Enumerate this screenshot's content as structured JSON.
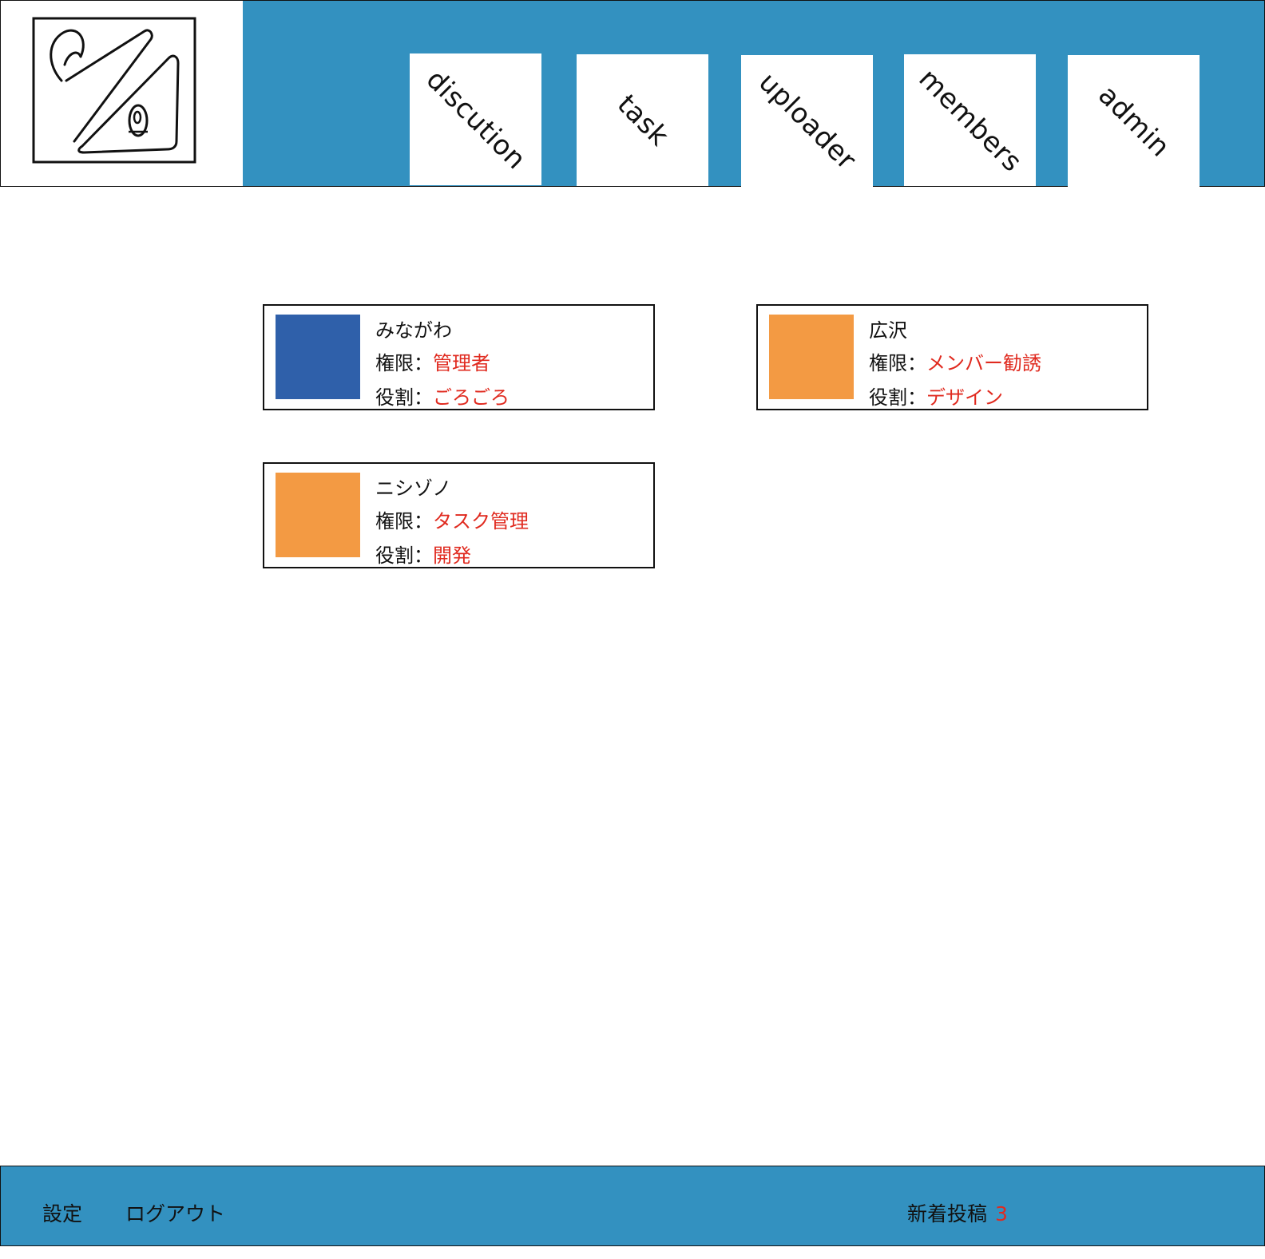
{
  "header": {
    "tabs": [
      {
        "label": "discution"
      },
      {
        "label": "task"
      },
      {
        "label": "uploader"
      },
      {
        "label": "members"
      },
      {
        "label": "admin"
      }
    ]
  },
  "members": [
    {
      "name": "みながわ",
      "auth_label": "権限：",
      "auth": "管理者",
      "role_label": "役割：",
      "role": "ごろごろ",
      "color": "#2f60aa"
    },
    {
      "name": "広沢",
      "auth_label": "権限：",
      "auth": "メンバー勧誘",
      "role_label": "役割：",
      "role": "デザイン",
      "color": "#f39a43"
    },
    {
      "name": "ニシゾノ",
      "auth_label": "権限：",
      "auth": "タスク管理",
      "role_label": "役割：",
      "role": "開発",
      "color": "#f39a43"
    }
  ],
  "footer": {
    "settings_label": "設定",
    "logout_label": "ログアウト",
    "new_posts_label": "新着投稿",
    "new_posts_count": "3"
  },
  "colors": {
    "header_bg": "#3391c0",
    "accent_text": "#e02a1f"
  }
}
